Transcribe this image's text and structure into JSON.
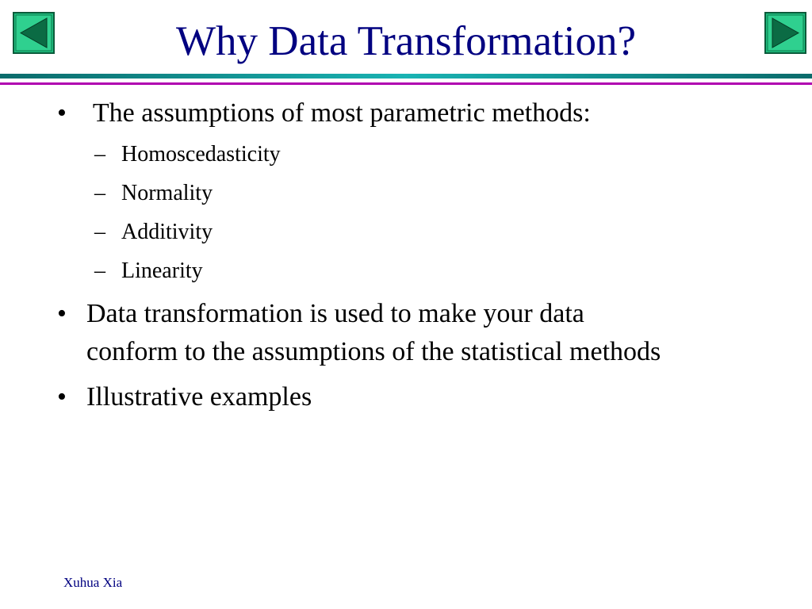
{
  "title": "Why Data Transformation?",
  "navigation": {
    "prev_icon": "triangle-left-icon",
    "next_icon": "triangle-right-icon",
    "button_fill": "#1fbf7f",
    "arrow_fill": "#0b6b44"
  },
  "bullets": [
    {
      "marker": "•",
      "text": " The assumptions of most parametric methods:",
      "sub_items": [
        {
          "marker": "–",
          "text": "Homoscedasticity"
        },
        {
          "marker": "–",
          "text": "Normality"
        },
        {
          "marker": "–",
          "text": "Additivity"
        },
        {
          "marker": "–",
          "text": "Linearity"
        }
      ]
    },
    {
      "marker": "•",
      "lines": [
        "Data transformation is used to make your data",
        "conform to the assumptions of the statistical methods"
      ]
    },
    {
      "marker": "•",
      "text": "Illustrative examples"
    }
  ],
  "footer": "Xuhua Xia",
  "colors": {
    "title": "#000080",
    "rule_teal": "#19b3b3",
    "rule_magenta": "#b000b0"
  }
}
